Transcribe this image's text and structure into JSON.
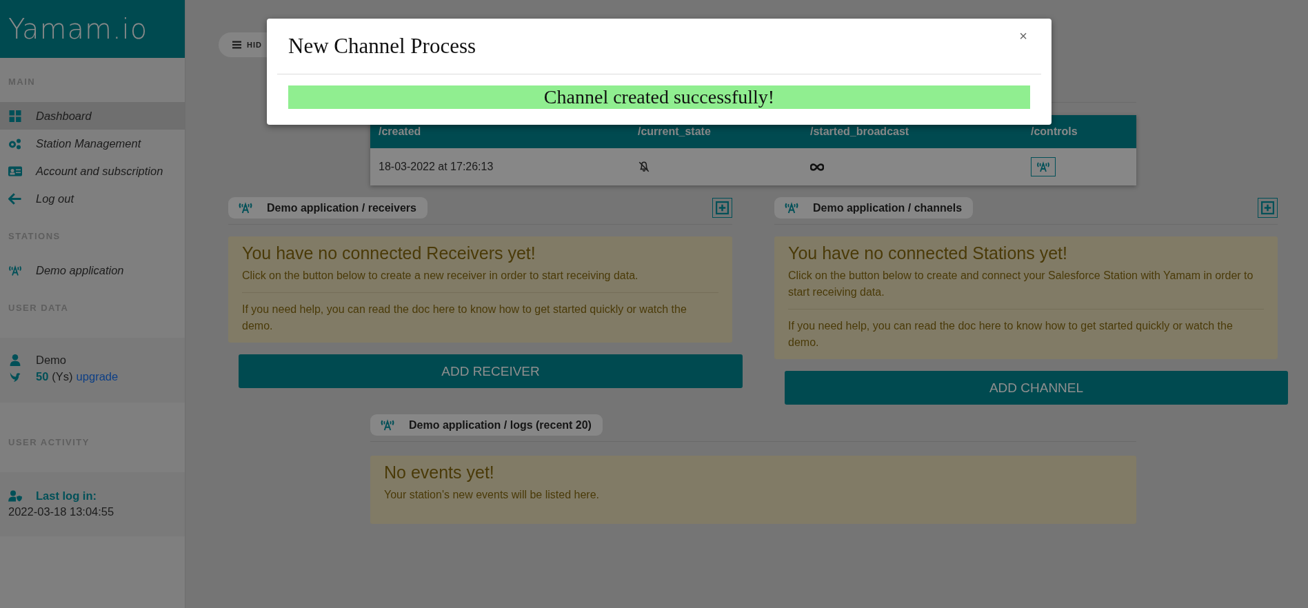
{
  "sidebar": {
    "logo": "Yamam.io",
    "sections": [
      {
        "title": "MAIN",
        "items": [
          {
            "label": "Dashboard",
            "kind": "grid",
            "selected": true
          },
          {
            "label": "Station Management",
            "kind": "gears",
            "selected": false
          },
          {
            "label": "Account and subscription",
            "kind": "card",
            "selected": false
          },
          {
            "label": "Log out",
            "kind": "arrow",
            "selected": false
          }
        ]
      },
      {
        "title": "STATIONS",
        "items": [
          {
            "label": "Demo application",
            "kind": "antenna",
            "selected": false
          }
        ]
      }
    ],
    "user_data": {
      "title": "USER DATA",
      "name": "Demo",
      "credits": "50",
      "unit": "(Ys)",
      "link": "upgrade"
    },
    "user_activity": {
      "title": "USER ACTIVITY",
      "label": "Last log in:",
      "value": "2022-03-18 13:04:55"
    }
  },
  "hide_button": "HID",
  "table": {
    "columns": [
      "/created",
      "/current_state",
      "/started_broadcast",
      "/controls"
    ],
    "rows": [
      {
        "created": "18-03-2022 at 17:26:13"
      }
    ]
  },
  "panels": [
    {
      "title": "Demo application / receivers",
      "heading": "You have no connected Receivers yet!",
      "text": "Click on the button below to create a new receiver in order to start receiving data.",
      "help": "If you need help, you can read the doc here to know how to get started quickly or watch the demo.",
      "button": "ADD RECEIVER"
    },
    {
      "title": "Demo application / channels",
      "heading": "You have no connected Stations yet!",
      "text": "Click on the button below to create and connect your Salesforce Station with Yamam in order to start receiving data.",
      "help": "If you need help, you can read the doc here to know how to get started quickly or watch the demo.",
      "button": "ADD CHANNEL"
    }
  ],
  "logs": {
    "title": "Demo application / logs (recent 20)",
    "heading": "No events yet!",
    "text": "Your station's new events will be listed here."
  },
  "modal": {
    "title": "New Channel Process",
    "close": "×",
    "message": "Channel created successfully!"
  }
}
